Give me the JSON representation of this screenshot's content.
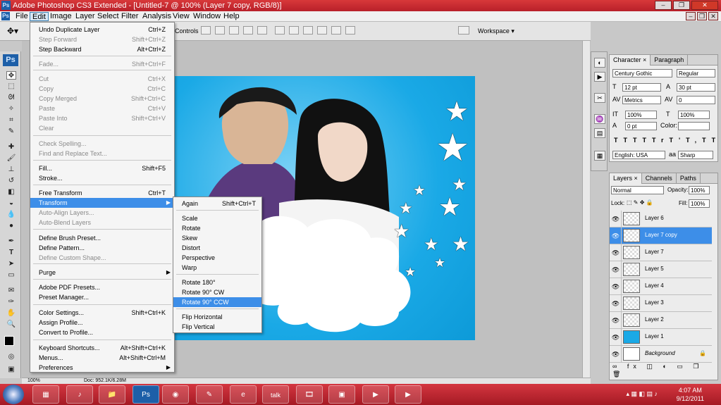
{
  "window": {
    "title": "Adobe Photoshop CS3 Extended - [Untitled-7 @ 100% (Layer 7 copy, RGB/8)]",
    "app_logo": "Ps"
  },
  "menubar": {
    "items": [
      "File",
      "Edit",
      "Image",
      "Layer",
      "Select",
      "Filter",
      "Analysis",
      "View",
      "Window",
      "Help"
    ],
    "active": "Edit"
  },
  "options_bar": {
    "label": "Controls",
    "workspace": "Workspace ▾"
  },
  "toolbox": {
    "logo": "Ps"
  },
  "edit_menu": {
    "items": [
      {
        "label": "Undo Duplicate Layer",
        "shortcut": "Ctrl+Z",
        "disabled": false
      },
      {
        "label": "Step Forward",
        "shortcut": "Shift+Ctrl+Z",
        "disabled": true
      },
      {
        "label": "Step Backward",
        "shortcut": "Alt+Ctrl+Z",
        "disabled": false
      },
      {
        "label": "Fade...",
        "shortcut": "Shift+Ctrl+F",
        "disabled": true
      },
      {
        "label": "Cut",
        "shortcut": "Ctrl+X",
        "disabled": true
      },
      {
        "label": "Copy",
        "shortcut": "Ctrl+C",
        "disabled": true
      },
      {
        "label": "Copy Merged",
        "shortcut": "Shift+Ctrl+C",
        "disabled": true
      },
      {
        "label": "Paste",
        "shortcut": "Ctrl+V",
        "disabled": true
      },
      {
        "label": "Paste Into",
        "shortcut": "Shift+Ctrl+V",
        "disabled": true
      },
      {
        "label": "Clear",
        "shortcut": "",
        "disabled": true
      },
      {
        "label": "Check Spelling...",
        "shortcut": "",
        "disabled": true
      },
      {
        "label": "Find and Replace Text...",
        "shortcut": "",
        "disabled": true
      },
      {
        "label": "Fill...",
        "shortcut": "Shift+F5",
        "disabled": false
      },
      {
        "label": "Stroke...",
        "shortcut": "",
        "disabled": false
      },
      {
        "label": "Free Transform",
        "shortcut": "Ctrl+T",
        "disabled": false
      },
      {
        "label": "Transform",
        "shortcut": "",
        "disabled": false
      },
      {
        "label": "Auto-Align Layers...",
        "shortcut": "",
        "disabled": true
      },
      {
        "label": "Auto-Blend Layers",
        "shortcut": "",
        "disabled": true
      },
      {
        "label": "Define Brush Preset...",
        "shortcut": "",
        "disabled": false
      },
      {
        "label": "Define Pattern...",
        "shortcut": "",
        "disabled": false
      },
      {
        "label": "Define Custom Shape...",
        "shortcut": "",
        "disabled": true
      },
      {
        "label": "Purge",
        "shortcut": "",
        "disabled": false
      },
      {
        "label": "Adobe PDF Presets...",
        "shortcut": "",
        "disabled": false
      },
      {
        "label": "Preset Manager...",
        "shortcut": "",
        "disabled": false
      },
      {
        "label": "Color Settings...",
        "shortcut": "Shift+Ctrl+K",
        "disabled": false
      },
      {
        "label": "Assign Profile...",
        "shortcut": "",
        "disabled": false
      },
      {
        "label": "Convert to Profile...",
        "shortcut": "",
        "disabled": false
      },
      {
        "label": "Keyboard Shortcuts...",
        "shortcut": "Alt+Shift+Ctrl+K",
        "disabled": false
      },
      {
        "label": "Menus...",
        "shortcut": "Alt+Shift+Ctrl+M",
        "disabled": false
      },
      {
        "label": "Preferences",
        "shortcut": "",
        "disabled": false
      }
    ]
  },
  "transform_submenu": {
    "items": [
      {
        "label": "Again",
        "shortcut": "Shift+Ctrl+T"
      },
      {
        "label": "Scale",
        "shortcut": ""
      },
      {
        "label": "Rotate",
        "shortcut": ""
      },
      {
        "label": "Skew",
        "shortcut": ""
      },
      {
        "label": "Distort",
        "shortcut": ""
      },
      {
        "label": "Perspective",
        "shortcut": ""
      },
      {
        "label": "Warp",
        "shortcut": ""
      },
      {
        "label": "Rotate 180°",
        "shortcut": ""
      },
      {
        "label": "Rotate 90° CW",
        "shortcut": ""
      },
      {
        "label": "Rotate 90° CCW",
        "shortcut": ""
      },
      {
        "label": "Flip Horizontal",
        "shortcut": ""
      },
      {
        "label": "Flip Vertical",
        "shortcut": ""
      }
    ],
    "highlighted": "Rotate 90° CCW"
  },
  "character_panel": {
    "tabs": [
      "Character ×",
      "Paragraph"
    ],
    "font_family": "Century Gothic",
    "font_style": "Regular",
    "font_size": "12 pt",
    "leading": "30 pt",
    "kerning": "Metrics",
    "tracking": "0",
    "vscale": "100%",
    "hscale": "100%",
    "baseline": "0 pt",
    "color_label": "Color:",
    "style_buttons": [
      "T",
      "T",
      "TT",
      "Tr",
      "T'",
      "T,",
      "T",
      "T"
    ],
    "language": "English: USA",
    "antialias": "Sharp",
    "aa_label": "aa"
  },
  "layers_panel": {
    "tabs": [
      "Layers ×",
      "Channels",
      "Paths"
    ],
    "blend_mode": "Normal",
    "opacity_label": "Opacity:",
    "opacity": "100%",
    "lock_label": "Lock:",
    "fill_label": "Fill:",
    "fill": "100%",
    "layers": [
      "Layer 6",
      "Layer 7 copy",
      "Layer 7",
      "Layer 5",
      "Layer 4",
      "Layer 3",
      "Layer 2",
      "Layer 1",
      "Background"
    ],
    "selected": "Layer 7 copy"
  },
  "status": {
    "zoom": "100%",
    "doc": "Doc: 952.1K/6.28M"
  },
  "taskbar": {
    "time": "4:07 AM",
    "date": "9/12/2011",
    "buttons": [
      "Ps",
      "talk"
    ]
  }
}
